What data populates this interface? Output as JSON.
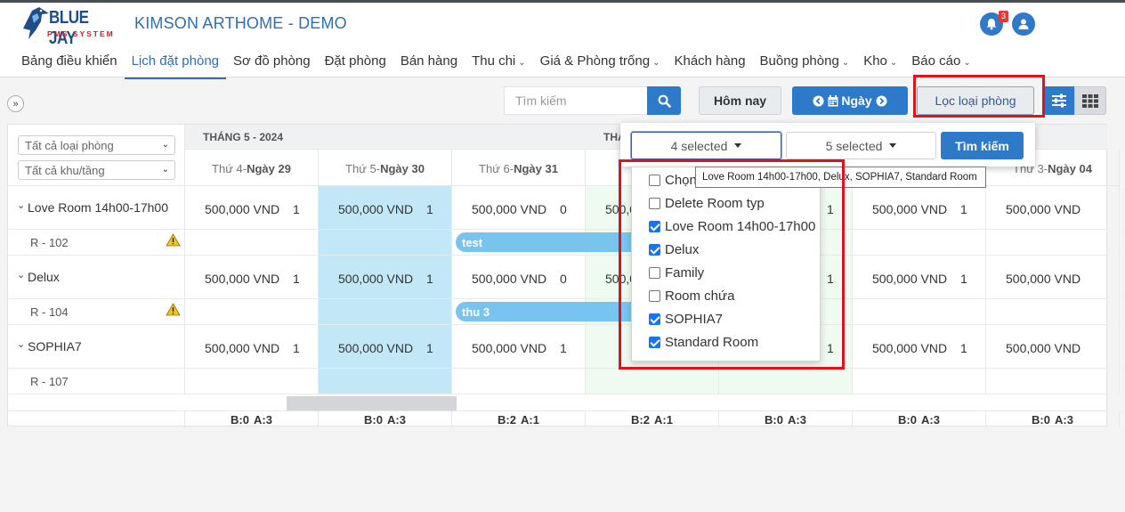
{
  "brand": {
    "name": "BLUE JAY",
    "tagline": "PMS SYSTEM"
  },
  "app_title": "KIMSON ARTHOME - DEMO",
  "notifications": {
    "count": "3"
  },
  "nav": [
    {
      "label": "Bảng điều khiển",
      "dropdown": false,
      "active": false
    },
    {
      "label": "Lịch đặt phòng",
      "dropdown": false,
      "active": true
    },
    {
      "label": "Sơ đồ phòng",
      "dropdown": false,
      "active": false
    },
    {
      "label": "Đặt phòng",
      "dropdown": false,
      "active": false
    },
    {
      "label": "Bán hàng",
      "dropdown": false,
      "active": false
    },
    {
      "label": "Thu chi",
      "dropdown": true,
      "active": false
    },
    {
      "label": "Giá & Phòng trống",
      "dropdown": true,
      "active": false
    },
    {
      "label": "Khách hàng",
      "dropdown": false,
      "active": false
    },
    {
      "label": "Buồng phòng",
      "dropdown": true,
      "active": false
    },
    {
      "label": "Kho",
      "dropdown": true,
      "active": false
    },
    {
      "label": "Báo cáo",
      "dropdown": true,
      "active": false
    }
  ],
  "toolbar": {
    "expand": "»",
    "search_placeholder": "Tìm kiếm",
    "today": "Hôm nay",
    "day": "Ngày",
    "filter_room_type": "Lọc loại phòng"
  },
  "filters": {
    "room_type": "Tất cả loại phòng",
    "area": "Tất cả khu/tầng"
  },
  "months": [
    "THÁNG 5 - 2024",
    "THÁ"
  ],
  "days": [
    {
      "weekday": "Thứ 4-",
      "day": "Ngày 29"
    },
    {
      "weekday": "Thứ 5-",
      "day": "Ngày 30"
    },
    {
      "weekday": "Thứ 6-",
      "day": "Ngày 31"
    },
    {
      "weekday": "Th",
      "day": ""
    },
    {
      "weekday": "",
      "day": ""
    },
    {
      "weekday": "",
      "day": ""
    },
    {
      "weekday": "Thứ 3-",
      "day": "Ngày 04"
    }
  ],
  "room_types": [
    {
      "name": "Love Room 14h00-17h00",
      "room": "R - 102",
      "prices": [
        "500,000 VND",
        "500,000 VND",
        "500,000 VND",
        "500,00",
        "",
        "500,000 VND",
        "500,000 VND"
      ],
      "avail": [
        "1",
        "1",
        "0",
        "",
        "1",
        "1",
        ""
      ],
      "booking": "test"
    },
    {
      "name": "Delux",
      "room": "R - 104",
      "prices": [
        "500,000 VND",
        "500,000 VND",
        "500,000 VND",
        "500,00",
        "",
        "500,000 VND",
        "500,000 VND"
      ],
      "avail": [
        "1",
        "1",
        "0",
        "",
        "1",
        "1",
        ""
      ],
      "booking": "thu 3"
    },
    {
      "name": "SOPHIA7",
      "room": "R - 107",
      "prices": [
        "500,000 VND",
        "500,000 VND",
        "500,000 VND",
        "",
        "",
        "500,000 VND",
        "500,000 VND"
      ],
      "avail": [
        "1",
        "1",
        "1",
        "",
        "1",
        "1",
        ""
      ],
      "booking": ""
    }
  ],
  "totals": [
    {
      "b": "B:0",
      "a": "A:3"
    },
    {
      "b": "B:0",
      "a": "A:3"
    },
    {
      "b": "B:2",
      "a": "A:1"
    },
    {
      "b": "B:2",
      "a": "A:1"
    },
    {
      "b": "B:0",
      "a": "A:3"
    },
    {
      "b": "B:0",
      "a": "A:3"
    },
    {
      "b": "B:0",
      "a": "A:3"
    }
  ],
  "popup": {
    "room_type_select": "4 selected",
    "area_select": "5 selected",
    "search_button": "Tìm kiếm",
    "options": [
      {
        "label": "Chọn",
        "checked": false
      },
      {
        "label": "Delete Room typ",
        "checked": false
      },
      {
        "label": "Love Room 14h00-17h00",
        "checked": true
      },
      {
        "label": "Delux",
        "checked": true
      },
      {
        "label": "Family",
        "checked": false
      },
      {
        "label": "Room chứa",
        "checked": false
      },
      {
        "label": "SOPHIA7",
        "checked": true
      },
      {
        "label": "Standard Room",
        "checked": true
      }
    ],
    "tooltip": "Love Room 14h00-17h00, Delux, SOPHIA7, Standard Room"
  },
  "colors": {
    "primary": "#2c7ac9",
    "highlight": "#c2e8f7",
    "booking": "#78c4ee",
    "annotation": "#e0121b"
  }
}
